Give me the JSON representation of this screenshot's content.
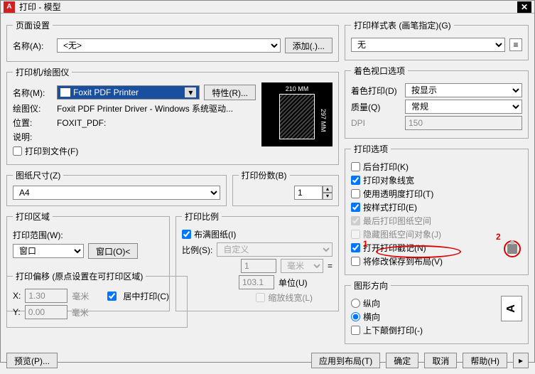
{
  "window": {
    "title": "打印 - 模型"
  },
  "page_setup": {
    "legend": "页面设置",
    "name_label": "名称(A):",
    "name_value": "<无>",
    "add_btn": "添加(.)..."
  },
  "printer": {
    "legend": "打印机/绘图仪",
    "name_label": "名称(M):",
    "name_value": "Foxit PDF Printer",
    "props_btn": "特性(R)...",
    "plotter_label": "绘图仪:",
    "plotter_value": "Foxit PDF Printer Driver - Windows 系统驱动...",
    "where_label": "位置:",
    "where_value": "FOXIT_PDF:",
    "desc_label": "说明:",
    "tofile_label": "打印到文件(F)",
    "preview_w": "210 MM",
    "preview_h": "297 MM"
  },
  "paper": {
    "legend": "图纸尺寸(Z)",
    "value": "A4"
  },
  "copies": {
    "legend": "打印份数(B)",
    "value": "1"
  },
  "area": {
    "legend": "打印区域",
    "what_label": "打印范围(W):",
    "what_value": "窗口",
    "window_btn": "窗口(O)<"
  },
  "scale": {
    "legend": "打印比例",
    "fit_label": "布满图纸(I)",
    "ratio_label": "比例(S):",
    "ratio_value": "自定义",
    "num_value": "1",
    "unit_label": "毫米",
    "den_value": "103.1",
    "den_label": "单位(U)",
    "lw_label": "缩放线宽(L)"
  },
  "offset": {
    "legend": "打印偏移 (原点设置在可打印区域)",
    "x_label": "X:",
    "x_value": "1.30",
    "x_unit": "毫米",
    "y_label": "Y:",
    "y_value": "0.00",
    "y_unit": "毫米",
    "center_label": "居中打印(C)"
  },
  "styletable": {
    "legend": "打印样式表 (画笔指定)(G)",
    "value": "无"
  },
  "shaded": {
    "legend": "着色视口选项",
    "shade_label": "着色打印(D)",
    "shade_value": "按显示",
    "quality_label": "质量(Q)",
    "quality_value": "常规",
    "dpi_label": "DPI",
    "dpi_value": "150"
  },
  "options": {
    "legend": "打印选项",
    "bg": "后台打印(K)",
    "lw": "打印对象线宽",
    "trans": "使用透明度打印(T)",
    "styles": "按样式打印(E)",
    "paperlast": "最后打印图纸空间",
    "hide": "隐藏图纸空间对象(J)",
    "stamp": "打开打印戳记(N)",
    "save": "将修改保存到布局(V)"
  },
  "orient": {
    "legend": "图形方向",
    "portrait": "纵向",
    "landscape": "横向",
    "upside": "上下颠倒打印(-)",
    "letter": "A"
  },
  "buttons": {
    "preview": "预览(P)...",
    "apply": "应用到布局(T)",
    "ok": "确定",
    "cancel": "取消",
    "help": "帮助(H)"
  },
  "anno": {
    "one": "1",
    "two": "2"
  }
}
